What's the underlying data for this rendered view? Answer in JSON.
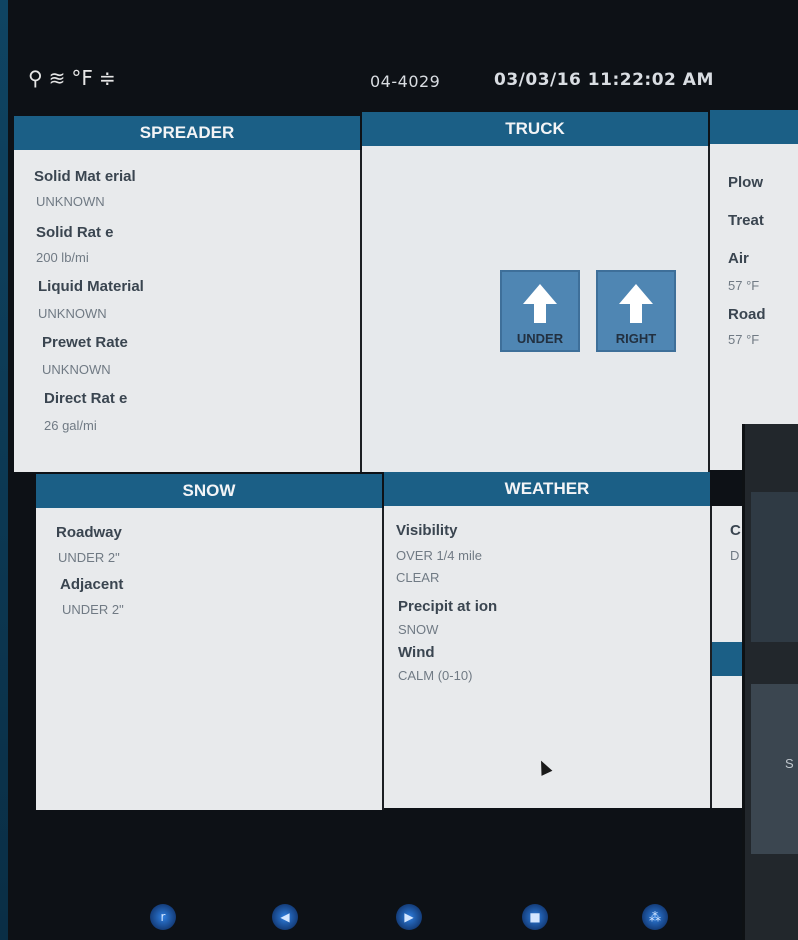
{
  "status_bar": {
    "icons": [
      "location-icon",
      "wifi-icon",
      "temperature-icon",
      "signal-icon"
    ],
    "icon_glyphs": [
      "⚲",
      "≋",
      "°F",
      "≑"
    ],
    "unit_id": "04-4029",
    "datetime": "03/03/16 11:22:02 AM"
  },
  "spreader": {
    "header": "SPREADER",
    "fields": [
      {
        "label": "Solid Mat erial",
        "value": "UNKNOWN"
      },
      {
        "label": "Solid Rat e",
        "value": "200 lb/mi"
      },
      {
        "label": "Liquid Material",
        "value": "UNKNOWN"
      },
      {
        "label": "Prewet Rate",
        "value": "UNKNOWN"
      },
      {
        "label": "Direct Rat e",
        "value": "26 gal/mi"
      }
    ]
  },
  "truck": {
    "header": "TRUCK",
    "buttons": [
      {
        "label": "UNDER"
      },
      {
        "label": "RIGHT"
      }
    ]
  },
  "right_panel": {
    "fields": [
      {
        "label": "Plow",
        "value": ""
      },
      {
        "label": "Treat",
        "value": ""
      },
      {
        "label": "Air",
        "value": "57 °F"
      },
      {
        "label": "Road",
        "value": "57 °F"
      }
    ],
    "lower_fragments": [
      "C",
      "D"
    ]
  },
  "snow": {
    "header": "SNOW",
    "fields": [
      {
        "label": "Roadway",
        "value": "UNDER 2\""
      },
      {
        "label": "Adjacent",
        "value": "UNDER 2\""
      }
    ]
  },
  "weather": {
    "header": "WEATHER",
    "fields": [
      {
        "label": "Visibility",
        "values": [
          "OVER 1/4 mile",
          "CLEAR"
        ]
      },
      {
        "label": "Precipit at ion",
        "values": [
          "SNOW"
        ]
      },
      {
        "label": "Wind",
        "values": [
          "CALM (0-10)"
        ]
      }
    ]
  },
  "overlay_device": {
    "fragment": "S"
  },
  "bottom_nav": {
    "buttons": [
      {
        "name": "home-icon",
        "glyph": "r"
      },
      {
        "name": "back-icon",
        "glyph": "◀"
      },
      {
        "name": "forward-icon",
        "glyph": "▶"
      },
      {
        "name": "window-icon",
        "glyph": "■"
      },
      {
        "name": "apps-icon",
        "glyph": "⁂"
      }
    ]
  }
}
